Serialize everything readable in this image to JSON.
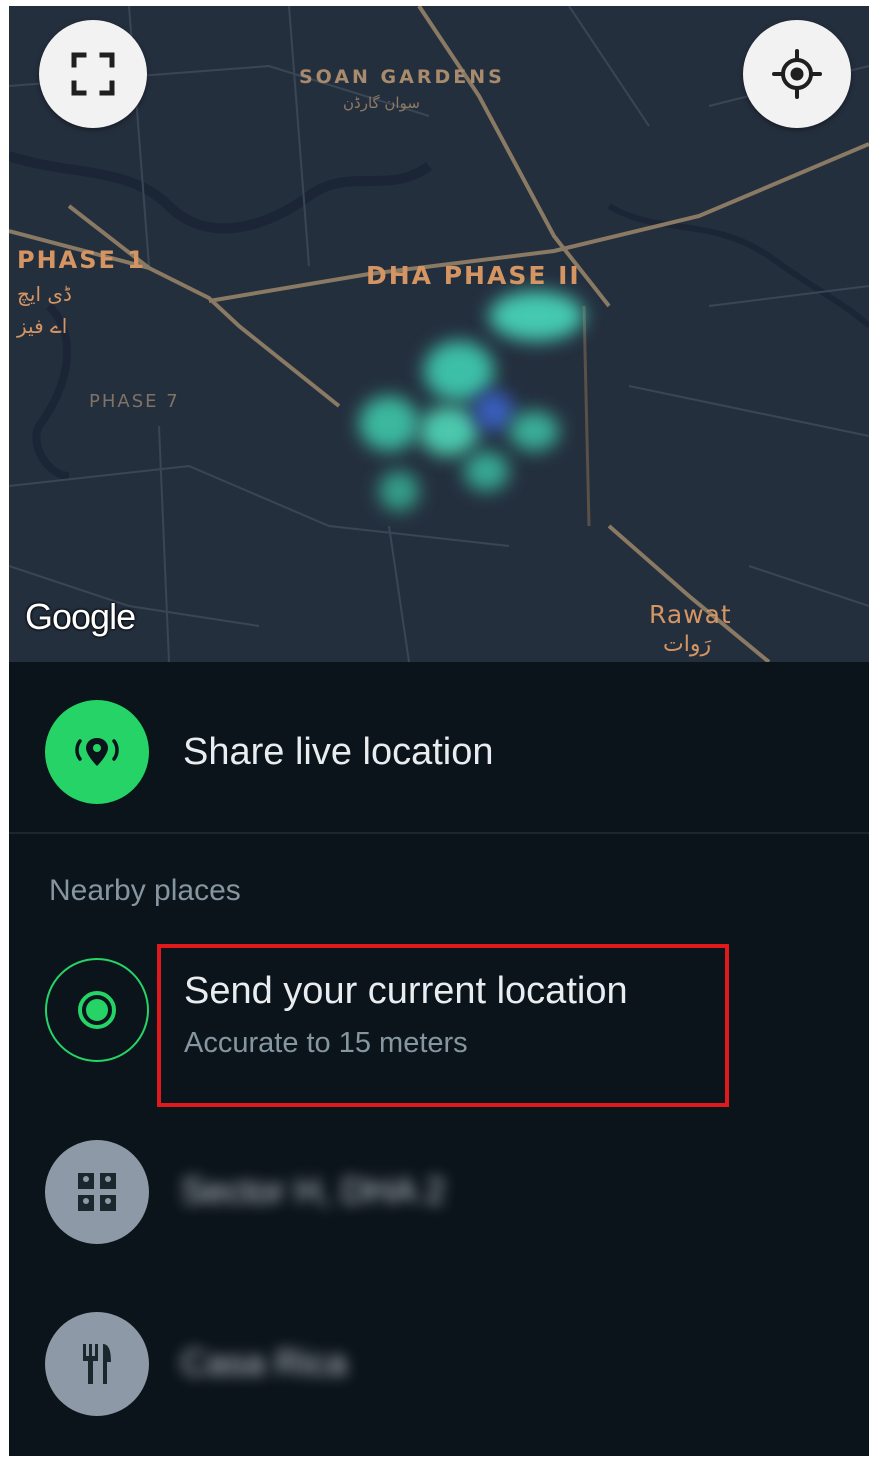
{
  "map": {
    "labels": {
      "soan_gardens": "SOAN GARDENS",
      "soan_gardens_urdu": "سوان گارڈن",
      "phase_1": "PHASE 1",
      "phase_1_urdu_line1": "ڈی ایچ",
      "phase_1_urdu_line2": "اے فیز",
      "dha_phase_ii": "DHA PHASE II",
      "phase_7": "PHASE 7",
      "rawat": "Rawat",
      "rawat_urdu": "رَوات"
    },
    "attribution": "Google",
    "buttons": {
      "fullscreen_icon": "fullscreen-icon",
      "my_location_icon": "my-location-icon"
    },
    "colors": {
      "background": "#242f3e",
      "road": "#8a7a63",
      "label": "#d59563",
      "heat": "#4fd1b8"
    }
  },
  "sheet": {
    "share_live": {
      "label": "Share live location",
      "icon": "live-location-icon"
    },
    "nearby_title": "Nearby places",
    "current_location": {
      "title": "Send your current location",
      "subtitle": "Accurate to 15 meters",
      "icon": "current-location-icon"
    },
    "places": [
      {
        "name": "Sector H, DHA 2",
        "icon": "building-icon"
      },
      {
        "name": "Casa Rica",
        "icon": "restaurant-icon"
      }
    ],
    "colors": {
      "accent": "#25d366",
      "highlight": "#e0191d",
      "background": "#0b141a",
      "text_primary": "#e9edef",
      "text_secondary": "#8696a0"
    }
  }
}
